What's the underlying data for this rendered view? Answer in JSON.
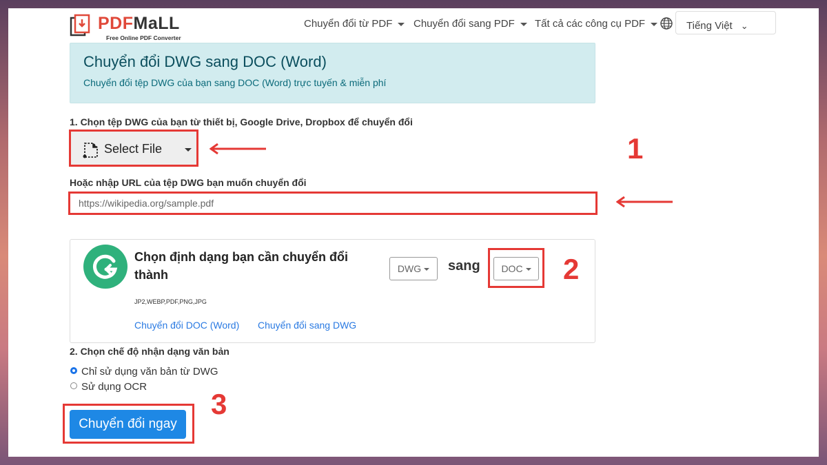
{
  "logo": {
    "brand_pdf": "PDF",
    "brand_mall": "MaLL",
    "tagline": "Free Online PDF Converter"
  },
  "nav": {
    "items": [
      {
        "label": "Chuyển đổi từ PDF"
      },
      {
        "label": "Chuyển đổi sang PDF"
      },
      {
        "label": "Tất cả các công cụ PDF"
      }
    ],
    "language": "Tiếng Việt"
  },
  "banner": {
    "title": "Chuyển đổi DWG sang DOC (Word)",
    "subtitle": "Chuyển đổi tệp DWG của bạn sang DOC (Word) trực tuyến & miễn phí"
  },
  "step1": {
    "label": "1. Chọn tệp DWG của bạn từ thiết bị, Google Drive, Dropbox để chuyển đổi",
    "select_file": "Select File",
    "url_label": "Hoặc nhập URL của tệp DWG bạn muốn chuyển đổi",
    "url_placeholder": "https://wikipedia.org/sample.pdf"
  },
  "format_card": {
    "title": "Chọn định dạng bạn cần chuyển đổi thành",
    "from": "DWG",
    "connector": "sang",
    "to": "DOC",
    "formats": "JP2,WEBP,PDF,PNG,JPG",
    "link1": "Chuyển đổi DOC (Word)",
    "link2": "Chuyển đổi sang DWG"
  },
  "step2": {
    "label": "2. Chọn chế độ nhận dạng văn bản",
    "option1": "Chỉ sử dụng văn bản từ DWG",
    "option2": "Sử dụng OCR",
    "selected": 1
  },
  "convert_button": "Chuyển đổi ngay",
  "annotations": {
    "n1": "1",
    "n2": "2",
    "n3": "3"
  },
  "colors": {
    "accent_red": "#e53935",
    "primary_blue": "#1e88e5",
    "banner_bg": "#d2ecef",
    "brand_green": "#2fb17c"
  }
}
